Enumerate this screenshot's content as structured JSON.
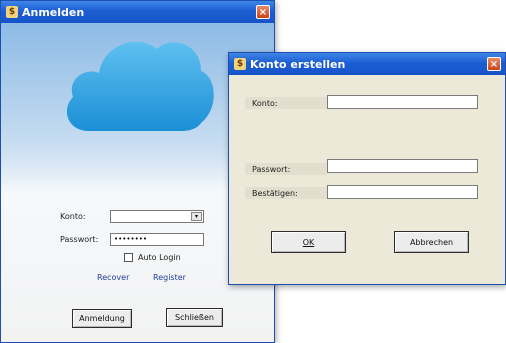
{
  "login_window": {
    "title": "Anmelden",
    "close_glyph": "×",
    "app_icon_glyph": "$",
    "konto_label": "Konto:",
    "konto_value": "",
    "combo_arrow": "▾",
    "passwort_label": "Passwort:",
    "passwort_value": "••••••••",
    "auto_login_label": "Auto Login",
    "auto_login_checked": false,
    "recover_link": "Recover",
    "register_link": "Register",
    "login_button": "Anmeldung",
    "close_button": "Schließen"
  },
  "create_window": {
    "title": "Konto erstellen",
    "close_glyph": "×",
    "app_icon_glyph": "$",
    "konto_label": "Konto:",
    "konto_value": "",
    "passwort_label": "Passwort:",
    "passwort_value": "",
    "bestaetigen_label": "Bestätigen:",
    "bestaetigen_value": "",
    "ok_button": "OK",
    "cancel_button": "Abbrechen"
  },
  "colors": {
    "titlebar": "#1c5ed4",
    "dialog_bg": "#ece9d8",
    "link": "#1f3f9a"
  },
  "icons": [
    "app-icon",
    "close-icon",
    "cloud-icon",
    "dropdown-arrow-icon"
  ]
}
